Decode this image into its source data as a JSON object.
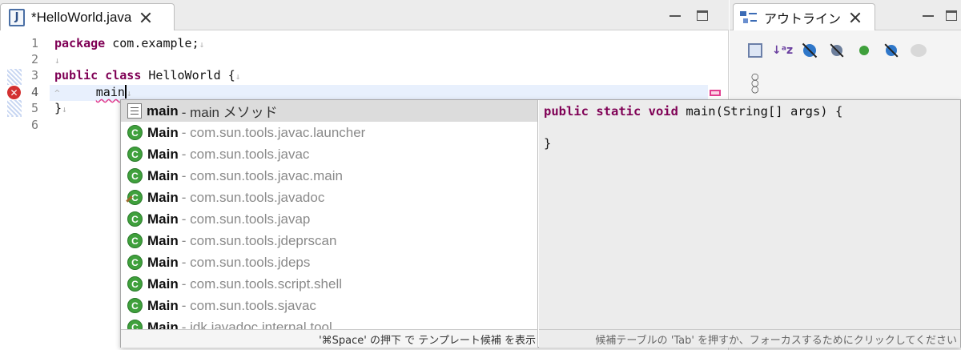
{
  "editor": {
    "tab_title": "*HelloWorld.java",
    "lines": [
      {
        "num": "1",
        "text": "com.example;"
      },
      {
        "num": "2",
        "text": ""
      },
      {
        "num": "3",
        "text": "HelloWorld {"
      },
      {
        "num": "4",
        "text": "main"
      },
      {
        "num": "5",
        "text": "}"
      },
      {
        "num": "6",
        "text": ""
      }
    ],
    "keywords": {
      "package": "package",
      "public": "public",
      "class": "class"
    },
    "whitespace_mark": "↓",
    "indent_mark": "^"
  },
  "outline": {
    "tab_title": "アウトライン"
  },
  "content_assist": {
    "proposals": [
      {
        "name": "main",
        "desc": "- main メソッド",
        "icon": "template-icon",
        "selected": true
      },
      {
        "name": "Main",
        "desc": "- com.sun.tools.javac.launcher",
        "icon": "class-icon"
      },
      {
        "name": "Main",
        "desc": "- com.sun.tools.javac",
        "icon": "class-icon"
      },
      {
        "name": "Main",
        "desc": "- com.sun.tools.javac.main",
        "icon": "class-icon"
      },
      {
        "name": "Main",
        "desc": "- com.sun.tools.javadoc",
        "icon": "deprecated-class-icon"
      },
      {
        "name": "Main",
        "desc": "- com.sun.tools.javap",
        "icon": "class-icon"
      },
      {
        "name": "Main",
        "desc": "- com.sun.tools.jdeprscan",
        "icon": "class-icon"
      },
      {
        "name": "Main",
        "desc": "- com.sun.tools.jdeps",
        "icon": "class-icon"
      },
      {
        "name": "Main",
        "desc": "- com.sun.tools.script.shell",
        "icon": "class-icon"
      },
      {
        "name": "Main",
        "desc": "- com.sun.tools.sjavac",
        "icon": "class-icon"
      },
      {
        "name": "Main",
        "desc": "- jdk.javadoc.internal.tool",
        "icon": "class-icon"
      }
    ],
    "preview_kw": "public static void",
    "preview_rest": " main(String[] args) {\n\n}",
    "status_left": "'⌘Space' の押下 で テンプレート候補 を表示",
    "status_right": "候補テーブルの 'Tab' を押すか、フォーカスするためにクリックしてください"
  }
}
